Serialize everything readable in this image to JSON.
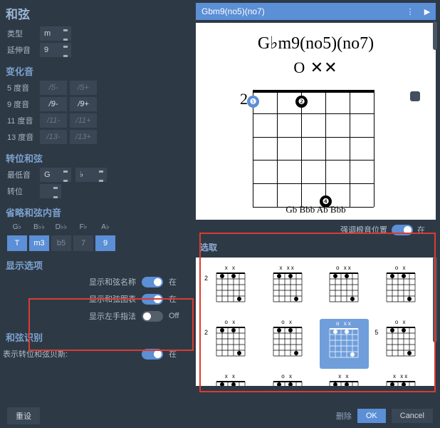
{
  "left": {
    "title": "和弦",
    "type_label": "类型",
    "type_value": "m",
    "ext_label": "延伸音",
    "ext_value": "9",
    "alter_title": "变化音",
    "alters": [
      {
        "label": "5 度音",
        "minus": "/5-",
        "plus": "/5+",
        "mOn": false,
        "pOn": false
      },
      {
        "label": "9 度音",
        "minus": "/9-",
        "plus": "/9+",
        "mOn": true,
        "pOn": true
      },
      {
        "label": "11 度音",
        "minus": "/11-",
        "plus": "/11+",
        "mOn": false,
        "pOn": false
      },
      {
        "label": "13 度音",
        "minus": "/13-",
        "plus": "/13+",
        "mOn": false,
        "pOn": false
      }
    ],
    "inv_title": "转位和弦",
    "bass_label": "最低音",
    "bass_note": "G",
    "bass_acc": "♭",
    "inv_label": "转位",
    "inv_value": "",
    "omit_title": "省略和弦内音",
    "note_heads": [
      "G♭",
      "B♭♭",
      "D♭♭",
      "F♭",
      "A♭"
    ],
    "note_cells": [
      {
        "t": "T",
        "on": true
      },
      {
        "t": "m3",
        "on": true
      },
      {
        "t": "b5",
        "on": false
      },
      {
        "t": "7",
        "on": false
      },
      {
        "t": "9",
        "on": true
      }
    ],
    "disp_title": "显示选项",
    "opts": [
      {
        "label": "显示和弦名称",
        "on": true,
        "state": "在"
      },
      {
        "label": "显示和弦图表",
        "on": true,
        "state": "在"
      },
      {
        "label": "显示左手指法",
        "on": false,
        "state": "Off"
      }
    ],
    "recog_title": "和弦识别",
    "recog_label": "表示转位和弦贝斯:",
    "recog_state": "在",
    "reset": "重设"
  },
  "right": {
    "bar_title": "Gbm9(no5)(no7)",
    "chord_name": "G♭m9(no5)(no7)",
    "top_marks": "O      ✕✕",
    "fret_start": "2",
    "bottom_names": "Gb Bbb Ab Bbb",
    "emph_label": "强调根音位置",
    "emph_state": "在",
    "pick_title": "选取",
    "minis": [
      {
        "f": "2",
        "t": "x   x",
        "sel": false
      },
      {
        "f": "",
        "t": "x  xx",
        "sel": false
      },
      {
        "f": "",
        "t": "o  xx",
        "sel": false
      },
      {
        "f": "",
        "t": "o   x",
        "sel": false
      },
      {
        "f": "2",
        "t": "o x  ",
        "sel": false
      },
      {
        "f": "",
        "t": "o  x ",
        "sel": false
      },
      {
        "f": "",
        "t": " o xx",
        "sel": true
      },
      {
        "f": "5",
        "t": "o x  ",
        "sel": false
      },
      {
        "f": "",
        "t": "x   x",
        "sel": false
      },
      {
        "f": "",
        "t": "o   x",
        "sel": false
      },
      {
        "f": "",
        "t": "x   x",
        "sel": false
      },
      {
        "f": "",
        "t": "x  xx",
        "sel": false
      }
    ]
  },
  "footer": {
    "delete": "删除",
    "ok": "OK",
    "cancel": "Cancel"
  }
}
